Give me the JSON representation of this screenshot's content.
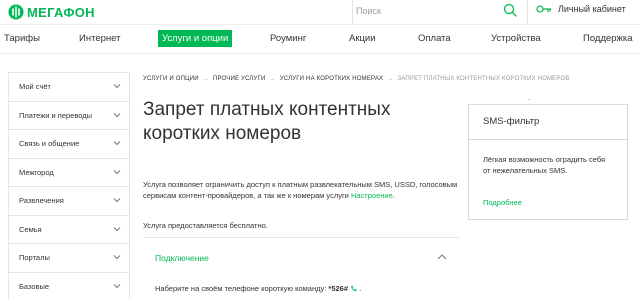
{
  "header": {
    "logo_text": "МЕГАФОН",
    "search_placeholder": "Поиск",
    "cabinet_label": "Личный кабинет",
    "brand_color": "#00b956"
  },
  "nav": {
    "items": [
      {
        "label": "Тарифы"
      },
      {
        "label": "Интернет"
      },
      {
        "label": "Услуги и опции",
        "active": true
      },
      {
        "label": "Роуминг"
      },
      {
        "label": "Акции"
      },
      {
        "label": "Оплата"
      },
      {
        "label": "Устройства"
      },
      {
        "label": "Поддержка"
      }
    ]
  },
  "sidebar": {
    "items": [
      {
        "label": "Мой счёт"
      },
      {
        "label": "Платежи и переводы"
      },
      {
        "label": "Связь и общение"
      },
      {
        "label": "Межгород"
      },
      {
        "label": "Развлечения"
      },
      {
        "label": "Семья"
      },
      {
        "label": "Порталы"
      },
      {
        "label": "Базовые"
      }
    ]
  },
  "breadcrumb": {
    "items": [
      "Услуги и опции",
      "Прочие услуги",
      "Услуги на коротких номерах"
    ],
    "current": "Запрет платных контентных коротких номеров"
  },
  "main": {
    "title": "Запрет платных контентных коротких номеров",
    "description": "Услуга позволяет ограничить доступ к платным развлекательным SMS, USSD, голосовым сервисам контент-провайдеров, а так же к номерам услуги ",
    "description_link": "Настроение",
    "description_end": ".",
    "free_text": "Услуга предоставляется бесплатно.",
    "accordion_title": "Подключение",
    "accordion_body_prefix": "Наберите на своём телефоне короткую команду: ",
    "accordion_code": "*526#",
    "accordion_body_suffix": " ."
  },
  "smsbox": {
    "title": "SMS-фильтр",
    "text": "Лёгкая возможность оградить себя от нежелательных SMS.",
    "link": "Подробнее",
    "link_end": "."
  }
}
